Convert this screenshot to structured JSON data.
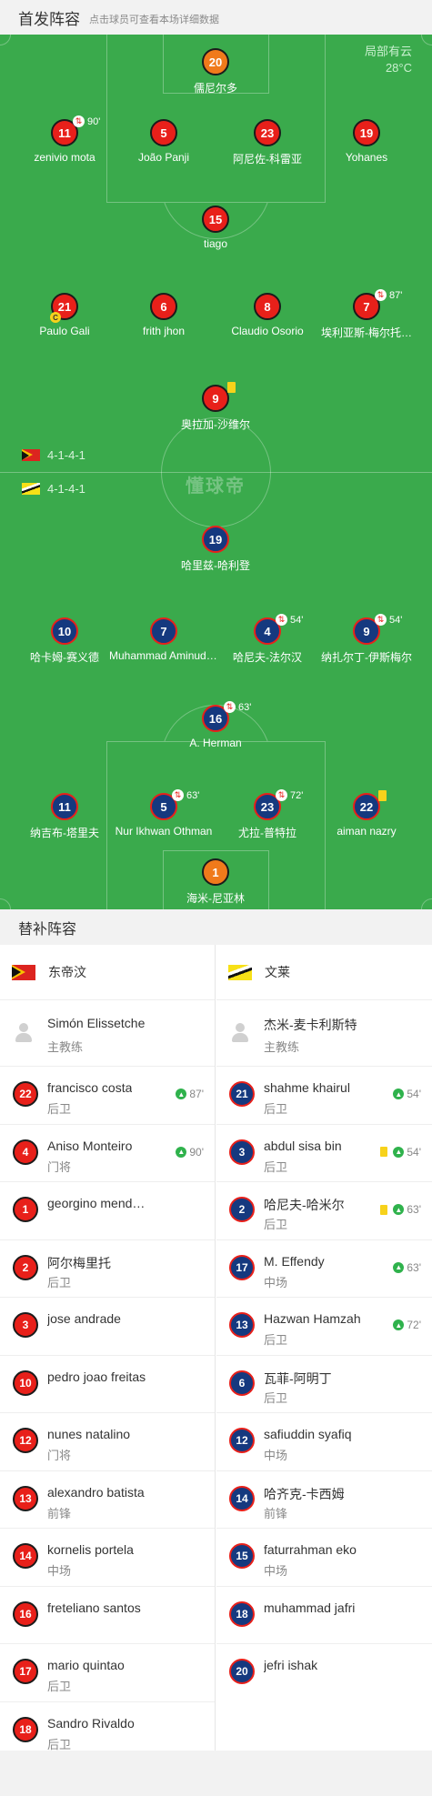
{
  "header": {
    "title": "首发阵容",
    "subtitle": "点击球员可查看本场详细数据"
  },
  "weather": {
    "condition": "局部有云",
    "temperature": "28°C"
  },
  "watermark": "懂球帝",
  "home": {
    "formation": "4-1-4-1",
    "players": [
      {
        "number": "20",
        "name": "儒尼尔多",
        "style": "orange"
      },
      {
        "number": "11",
        "name": "zenivio mota",
        "style": "red",
        "sub": "90'"
      },
      {
        "number": "5",
        "name": "João Panji",
        "style": "red"
      },
      {
        "number": "23",
        "name": "阿尼佐-科雷亚",
        "style": "red"
      },
      {
        "number": "19",
        "name": "Yohanes",
        "style": "red"
      },
      {
        "number": "15",
        "name": "tiago",
        "style": "red"
      },
      {
        "number": "21",
        "name": "Paulo Gali",
        "style": "red",
        "captain": "C"
      },
      {
        "number": "6",
        "name": "frith jhon",
        "style": "red"
      },
      {
        "number": "8",
        "name": "Claudio Osorio",
        "style": "red"
      },
      {
        "number": "7",
        "name": "埃利亚斯-梅尔托…",
        "style": "red",
        "sub": "87'"
      },
      {
        "number": "9",
        "name": "奥拉加-沙维尔",
        "style": "red",
        "yellow": true
      }
    ]
  },
  "away": {
    "formation": "4-1-4-1",
    "players": [
      {
        "number": "19",
        "name": "哈里兹-哈利登",
        "style": "blue"
      },
      {
        "number": "10",
        "name": "哈卡姆-赛义德",
        "style": "blue"
      },
      {
        "number": "7",
        "name": "Muhammad Aminuddin",
        "style": "blue"
      },
      {
        "number": "4",
        "name": "哈尼夫-法尔汉",
        "style": "blue",
        "sub": "54'"
      },
      {
        "number": "9",
        "name": "纳扎尔丁-伊斯梅尔",
        "style": "blue",
        "sub": "54'"
      },
      {
        "number": "16",
        "name": "A. Herman",
        "style": "blue",
        "sub": "63'"
      },
      {
        "number": "11",
        "name": "纳吉布-塔里夫",
        "style": "blue"
      },
      {
        "number": "5",
        "name": "Nur Ikhwan Othman",
        "style": "blue",
        "sub": "63'"
      },
      {
        "number": "23",
        "name": "尤拉-普特拉",
        "style": "blue",
        "sub": "72'"
      },
      {
        "number": "22",
        "name": "aiman nazry",
        "style": "blue",
        "yellow": true
      },
      {
        "number": "1",
        "name": "海米-尼亚林",
        "style": "orange"
      }
    ]
  },
  "subs": {
    "title": "替补阵容",
    "home": {
      "team": "东帝汶",
      "coach": {
        "name": "Simón Elissetche",
        "role": "主教练"
      },
      "players": [
        {
          "number": "22",
          "name": "francisco costa",
          "pos": "后卫",
          "event": "87'"
        },
        {
          "number": "4",
          "name": "Aniso Monteiro",
          "pos": "门将",
          "event": "90'"
        },
        {
          "number": "1",
          "name": "georgino mendonca",
          "pos": ""
        },
        {
          "number": "2",
          "name": "阿尔梅里托",
          "pos": "后卫"
        },
        {
          "number": "3",
          "name": "jose andrade",
          "pos": ""
        },
        {
          "number": "10",
          "name": "pedro joao freitas",
          "pos": ""
        },
        {
          "number": "12",
          "name": "nunes natalino",
          "pos": "门将"
        },
        {
          "number": "13",
          "name": "alexandro batista",
          "pos": "前锋"
        },
        {
          "number": "14",
          "name": "kornelis portela",
          "pos": "中场"
        },
        {
          "number": "16",
          "name": "freteliano santos",
          "pos": ""
        },
        {
          "number": "17",
          "name": "mario quintao",
          "pos": "后卫"
        },
        {
          "number": "18",
          "name": "Sandro Rivaldo",
          "pos": "后卫"
        }
      ]
    },
    "away": {
      "team": "文莱",
      "coach": {
        "name": "杰米-麦卡利斯特",
        "role": "主教练"
      },
      "players": [
        {
          "number": "21",
          "name": "shahme khairul",
          "pos": "后卫",
          "event": "54'"
        },
        {
          "number": "3",
          "name": "abdul sisa bin",
          "pos": "后卫",
          "event": "54'",
          "yellow": true
        },
        {
          "number": "2",
          "name": "哈尼夫-哈米尔",
          "pos": "后卫",
          "event": "63'",
          "yellow": true
        },
        {
          "number": "17",
          "name": "M. Effendy",
          "pos": "中场",
          "event": "63'"
        },
        {
          "number": "13",
          "name": "Hazwan Hamzah",
          "pos": "后卫",
          "event": "72'"
        },
        {
          "number": "6",
          "name": "瓦菲-阿明丁",
          "pos": "后卫"
        },
        {
          "number": "12",
          "name": "safiuddin syafiq",
          "pos": "中场"
        },
        {
          "number": "14",
          "name": "哈齐克-卡西姆",
          "pos": "前锋"
        },
        {
          "number": "15",
          "name": "faturrahman eko",
          "pos": "中场"
        },
        {
          "number": "18",
          "name": "muhammad jafri",
          "pos": ""
        },
        {
          "number": "20",
          "name": "jefri ishak",
          "pos": ""
        }
      ]
    }
  }
}
